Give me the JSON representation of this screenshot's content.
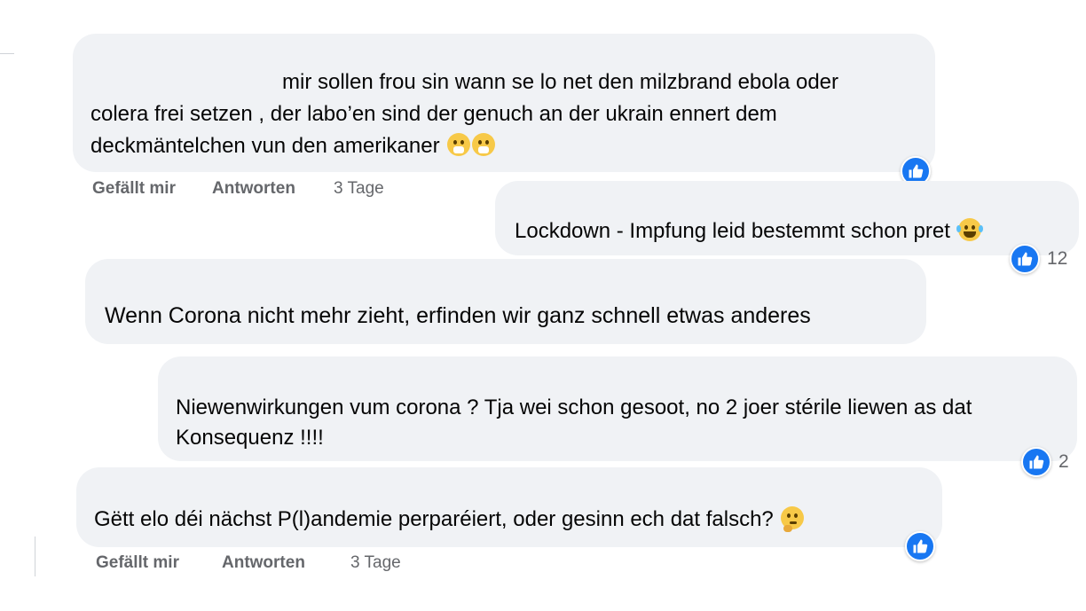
{
  "colors": {
    "bubble": "#f0f2f5",
    "like": "#1877f2",
    "meta": "#65676b"
  },
  "comments": [
    {
      "line1": "mir sollen frou sin wann se lo net den milzbrand ebola oder",
      "line2": "colera frei setzen , der labo’en sind der genuch an der ukrain ennert dem",
      "line3": "deckmäntelchen vun den amerikaner",
      "emoji": "face-with-hands-over-mouth",
      "like_label": "Gefällt mir",
      "reply_label": "Antworten",
      "time": "3 Tage"
    },
    {
      "line1": "Lockdown - Impfung leid bestemmt schon pret",
      "emoji": "face-with-tears-of-joy",
      "reaction_count": "12"
    },
    {
      "line1": "Wenn Corona nicht mehr zieht, erfinden wir ganz schnell etwas anderes"
    },
    {
      "line1": "Niewenwirkungen vum corona ? Tja wei schon gesoot, no 2 joer stérile liewen as dat",
      "line2": "Konsequenz !!!!",
      "reaction_count": "2"
    },
    {
      "line1": "Gëtt elo déi nächst P(l)andemie perparéiert, oder gesinn ech dat falsch?",
      "emoji": "thinking-face",
      "like_label": "Gefällt mir",
      "reply_label": "Antworten",
      "time": "3 Tage"
    }
  ]
}
